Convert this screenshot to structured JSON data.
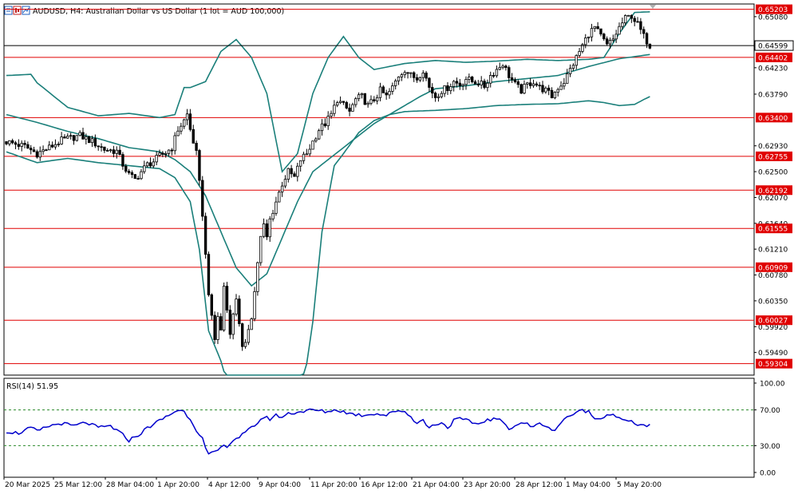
{
  "window": {
    "title": "AUDUSD, H4:  Australian Dollar vs US Dollar (1 lot = AUD 100,000)",
    "icons": [
      "chart-bars-icon",
      "candles-icon",
      "line-chart-icon"
    ]
  },
  "colors": {
    "background": "#ffffff",
    "bull_candle": "#ffffff",
    "bear_candle": "#000000",
    "candle_outline": "#000000",
    "bollinger": "#1a7f7a",
    "level_line": "#e00000",
    "level_label_bg": "#e00000",
    "current_line": "#000000",
    "rsi_line": "#0000cc",
    "rsi_levels": "#2a8a2a",
    "frame": "#000000"
  },
  "chart_data": {
    "type": "candlestick",
    "symbol": "AUDUSD",
    "timeframe": "H4",
    "price_axis": {
      "range": [
        0.592,
        0.653
      ],
      "ticks": [
        "0.65080",
        "0.64230",
        "0.63790",
        "0.62930",
        "0.62500",
        "0.62070",
        "0.61640",
        "0.61210",
        "0.60780",
        "0.60350",
        "0.59920",
        "0.59490"
      ],
      "current_price": "0.64599"
    },
    "levels": [
      "0.65203",
      "0.64402",
      "0.63400",
      "0.62755",
      "0.62192",
      "0.61555",
      "0.60909",
      "0.60027",
      "0.59304"
    ],
    "time_axis": {
      "labels": [
        "20 Mar 2025",
        "25 Mar 12:00",
        "28 Mar 04:00",
        "1 Apr 20:00",
        "4 Apr 12:00",
        "9 Apr 04:00",
        "11 Apr 20:00",
        "16 Apr 12:00",
        "21 Apr 04:00",
        "23 Apr 20:00",
        "28 Apr 12:00",
        "1 May 04:00",
        "5 May 20:00"
      ]
    },
    "close_path": [
      [
        0,
        0.63
      ],
      [
        6,
        0.6292
      ],
      [
        10,
        0.628
      ],
      [
        14,
        0.629
      ],
      [
        18,
        0.6302
      ],
      [
        24,
        0.631
      ],
      [
        28,
        0.63
      ],
      [
        32,
        0.6287
      ],
      [
        36,
        0.6284
      ],
      [
        38,
        0.6262
      ],
      [
        40,
        0.6245
      ],
      [
        42,
        0.6237
      ],
      [
        44,
        0.625
      ],
      [
        46,
        0.6262
      ],
      [
        48,
        0.6267
      ],
      [
        50,
        0.6276
      ],
      [
        52,
        0.6282
      ],
      [
        54,
        0.629
      ],
      [
        56,
        0.632
      ],
      [
        58,
        0.6335
      ],
      [
        59,
        0.6345
      ],
      [
        60,
        0.632
      ],
      [
        62,
        0.628
      ],
      [
        63,
        0.623
      ],
      [
        64,
        0.618
      ],
      [
        65,
        0.611
      ],
      [
        66,
        0.605
      ],
      [
        67,
        0.6005
      ],
      [
        68,
        0.597
      ],
      [
        69,
        0.601
      ],
      [
        70,
        0.5985
      ],
      [
        71,
        0.606
      ],
      [
        72,
        0.602
      ],
      [
        73,
        0.5985
      ],
      [
        74,
        0.601
      ],
      [
        75,
        0.604
      ],
      [
        76,
        0.6
      ],
      [
        77,
        0.5955
      ],
      [
        78,
        0.596
      ],
      [
        79,
        0.599
      ],
      [
        80,
        0.601
      ],
      [
        81,
        0.605
      ],
      [
        82,
        0.61
      ],
      [
        83,
        0.614
      ],
      [
        84,
        0.616
      ],
      [
        85,
        0.614
      ],
      [
        86,
        0.617
      ],
      [
        88,
        0.62
      ],
      [
        90,
        0.623
      ],
      [
        92,
        0.625
      ],
      [
        94,
        0.624
      ],
      [
        96,
        0.627
      ],
      [
        98,
        0.628
      ],
      [
        100,
        0.63
      ],
      [
        102,
        0.632
      ],
      [
        104,
        0.633
      ],
      [
        106,
        0.6345
      ],
      [
        108,
        0.637
      ],
      [
        110,
        0.636
      ],
      [
        112,
        0.635
      ],
      [
        114,
        0.637
      ],
      [
        116,
        0.6375
      ],
      [
        118,
        0.636
      ],
      [
        120,
        0.637
      ],
      [
        122,
        0.6385
      ],
      [
        124,
        0.6375
      ],
      [
        126,
        0.639
      ],
      [
        128,
        0.641
      ],
      [
        130,
        0.642
      ],
      [
        132,
        0.641
      ],
      [
        134,
        0.6405
      ],
      [
        136,
        0.642
      ],
      [
        138,
        0.639
      ],
      [
        140,
        0.6375
      ],
      [
        142,
        0.6385
      ],
      [
        144,
        0.639
      ],
      [
        146,
        0.64
      ],
      [
        148,
        0.6395
      ],
      [
        150,
        0.6405
      ],
      [
        152,
        0.64
      ],
      [
        154,
        0.6398
      ],
      [
        156,
        0.6392
      ],
      [
        158,
        0.641
      ],
      [
        160,
        0.642
      ],
      [
        162,
        0.643
      ],
      [
        164,
        0.641
      ],
      [
        166,
        0.6395
      ],
      [
        168,
        0.6385
      ],
      [
        170,
        0.6395
      ],
      [
        172,
        0.64
      ],
      [
        174,
        0.639
      ],
      [
        176,
        0.6385
      ],
      [
        178,
        0.6375
      ],
      [
        180,
        0.639
      ],
      [
        182,
        0.64
      ],
      [
        184,
        0.642
      ],
      [
        186,
        0.644
      ],
      [
        188,
        0.646
      ],
      [
        190,
        0.648
      ],
      [
        192,
        0.649
      ],
      [
        194,
        0.6475
      ],
      [
        196,
        0.646
      ],
      [
        198,
        0.647
      ],
      [
        200,
        0.649
      ],
      [
        202,
        0.6505
      ],
      [
        204,
        0.651
      ],
      [
        206,
        0.6495
      ],
      [
        208,
        0.6475
      ],
      [
        210,
        0.646
      ]
    ],
    "bollinger_bands": {
      "middle": [
        [
          0,
          0.6345
        ],
        [
          10,
          0.6332
        ],
        [
          20,
          0.6317
        ],
        [
          30,
          0.6305
        ],
        [
          40,
          0.629
        ],
        [
          50,
          0.6283
        ],
        [
          55,
          0.627
        ],
        [
          60,
          0.625
        ],
        [
          65,
          0.621
        ],
        [
          70,
          0.615
        ],
        [
          75,
          0.609
        ],
        [
          80,
          0.606
        ],
        [
          85,
          0.608
        ],
        [
          90,
          0.614
        ],
        [
          95,
          0.62
        ],
        [
          100,
          0.625
        ],
        [
          110,
          0.629
        ],
        [
          115,
          0.631
        ],
        [
          120,
          0.633
        ],
        [
          125,
          0.6345
        ],
        [
          130,
          0.636
        ],
        [
          135,
          0.6375
        ],
        [
          140,
          0.6388
        ],
        [
          150,
          0.6393
        ],
        [
          160,
          0.64
        ],
        [
          170,
          0.6405
        ],
        [
          180,
          0.641
        ],
        [
          190,
          0.6425
        ],
        [
          200,
          0.6438
        ],
        [
          210,
          0.6445
        ]
      ],
      "upper": [
        [
          0,
          0.641
        ],
        [
          8,
          0.6412
        ],
        [
          10,
          0.6398
        ],
        [
          20,
          0.6357
        ],
        [
          30,
          0.6343
        ],
        [
          40,
          0.6347
        ],
        [
          50,
          0.634
        ],
        [
          55,
          0.6345
        ],
        [
          58,
          0.639
        ],
        [
          60,
          0.639
        ],
        [
          65,
          0.64
        ],
        [
          70,
          0.645
        ],
        [
          75,
          0.647
        ],
        [
          80,
          0.644
        ],
        [
          85,
          0.638
        ],
        [
          90,
          0.625
        ],
        [
          95,
          0.628
        ],
        [
          100,
          0.638
        ],
        [
          105,
          0.644
        ],
        [
          110,
          0.6475
        ],
        [
          115,
          0.644
        ],
        [
          120,
          0.642
        ],
        [
          125,
          0.6425
        ],
        [
          130,
          0.643
        ],
        [
          140,
          0.6435
        ],
        [
          150,
          0.6432
        ],
        [
          160,
          0.6434
        ],
        [
          170,
          0.6437
        ],
        [
          180,
          0.6435
        ],
        [
          190,
          0.6437
        ],
        [
          195,
          0.644
        ],
        [
          200,
          0.648
        ],
        [
          205,
          0.6515
        ],
        [
          210,
          0.6516
        ]
      ],
      "lower": [
        [
          0,
          0.6283
        ],
        [
          10,
          0.6265
        ],
        [
          20,
          0.6272
        ],
        [
          30,
          0.6265
        ],
        [
          40,
          0.626
        ],
        [
          50,
          0.6255
        ],
        [
          55,
          0.624
        ],
        [
          60,
          0.62
        ],
        [
          63,
          0.612
        ],
        [
          66,
          0.5985
        ],
        [
          68,
          0.596
        ],
        [
          70,
          0.5935
        ],
        [
          72,
          0.59
        ],
        [
          80,
          0.589
        ],
        [
          90,
          0.586
        ],
        [
          95,
          0.588
        ],
        [
          98,
          0.593
        ],
        [
          100,
          0.6
        ],
        [
          103,
          0.615
        ],
        [
          107,
          0.626
        ],
        [
          110,
          0.628
        ],
        [
          115,
          0.6315
        ],
        [
          120,
          0.6335
        ],
        [
          125,
          0.6345
        ],
        [
          130,
          0.635
        ],
        [
          140,
          0.6352
        ],
        [
          150,
          0.6355
        ],
        [
          160,
          0.636
        ],
        [
          170,
          0.6362
        ],
        [
          180,
          0.6363
        ],
        [
          190,
          0.6368
        ],
        [
          195,
          0.6365
        ],
        [
          200,
          0.636
        ],
        [
          205,
          0.6362
        ],
        [
          208,
          0.637
        ],
        [
          210,
          0.6375
        ]
      ]
    },
    "rsi": {
      "title": "RSI(14) 51.95",
      "period": 14,
      "range": [
        0,
        100
      ],
      "ticks": [
        "100.00",
        "70.00",
        "30.00",
        "0.00"
      ],
      "levels": [
        70,
        30
      ],
      "values": [
        [
          0,
          46
        ],
        [
          4,
          44
        ],
        [
          8,
          50
        ],
        [
          10,
          46
        ],
        [
          14,
          52
        ],
        [
          18,
          55
        ],
        [
          22,
          52
        ],
        [
          26,
          56
        ],
        [
          30,
          50
        ],
        [
          34,
          52
        ],
        [
          38,
          42
        ],
        [
          40,
          36
        ],
        [
          44,
          44
        ],
        [
          46,
          50
        ],
        [
          50,
          58
        ],
        [
          52,
          62
        ],
        [
          54,
          66
        ],
        [
          56,
          70
        ],
        [
          58,
          68
        ],
        [
          60,
          60
        ],
        [
          62,
          48
        ],
        [
          64,
          38
        ],
        [
          65,
          26
        ],
        [
          66,
          20
        ],
        [
          68,
          22
        ],
        [
          70,
          28
        ],
        [
          72,
          30
        ],
        [
          74,
          36
        ],
        [
          76,
          40
        ],
        [
          78,
          44
        ],
        [
          80,
          50
        ],
        [
          82,
          56
        ],
        [
          84,
          62
        ],
        [
          86,
          60
        ],
        [
          88,
          64
        ],
        [
          90,
          62
        ],
        [
          92,
          66
        ],
        [
          96,
          68
        ],
        [
          100,
          70
        ],
        [
          104,
          68
        ],
        [
          108,
          70
        ],
        [
          112,
          66
        ],
        [
          116,
          64
        ],
        [
          120,
          66
        ],
        [
          124,
          64
        ],
        [
          128,
          70
        ],
        [
          130,
          68
        ],
        [
          132,
          62
        ],
        [
          134,
          56
        ],
        [
          136,
          58
        ],
        [
          138,
          50
        ],
        [
          140,
          54
        ],
        [
          142,
          56
        ],
        [
          144,
          50
        ],
        [
          146,
          58
        ],
        [
          148,
          60
        ],
        [
          150,
          58
        ],
        [
          154,
          54
        ],
        [
          156,
          58
        ],
        [
          160,
          60
        ],
        [
          162,
          56
        ],
        [
          164,
          50
        ],
        [
          166,
          52
        ],
        [
          168,
          56
        ],
        [
          170,
          54
        ],
        [
          172,
          50
        ],
        [
          174,
          56
        ],
        [
          176,
          52
        ],
        [
          178,
          46
        ],
        [
          180,
          52
        ],
        [
          182,
          60
        ],
        [
          184,
          64
        ],
        [
          186,
          66
        ],
        [
          188,
          70
        ],
        [
          190,
          68
        ],
        [
          192,
          60
        ],
        [
          194,
          62
        ],
        [
          196,
          64
        ],
        [
          198,
          66
        ],
        [
          200,
          60
        ],
        [
          202,
          58
        ],
        [
          206,
          54
        ],
        [
          210,
          52
        ]
      ]
    }
  }
}
